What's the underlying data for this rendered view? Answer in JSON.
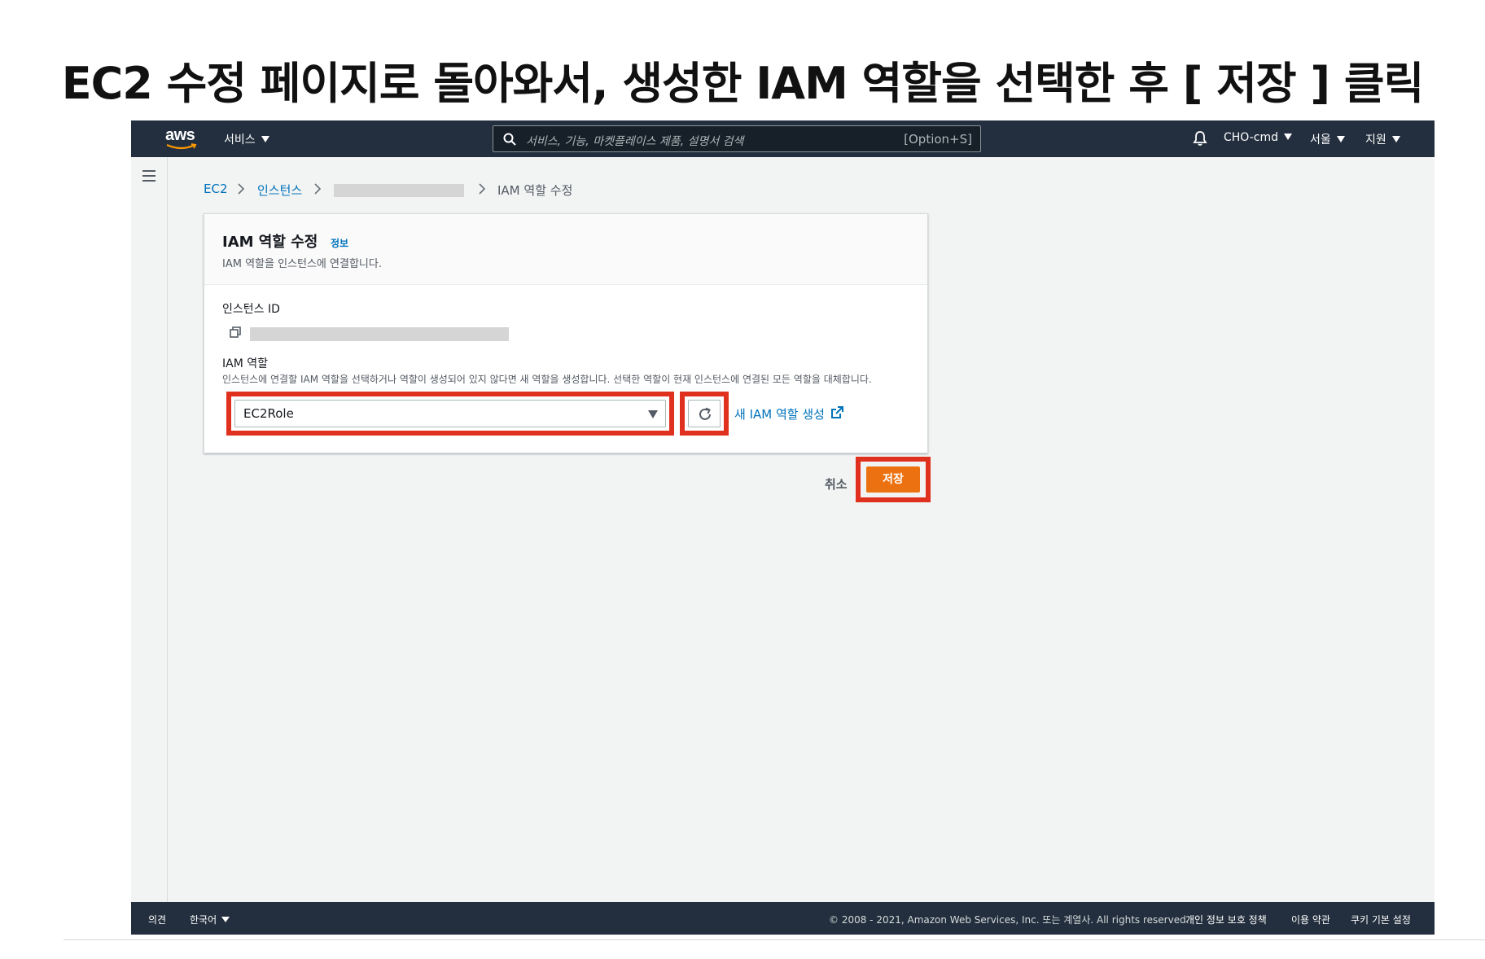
{
  "slide": {
    "title": "EC2 수정 페이지로 돌아와서, 생성한 IAM 역할을 선택한 후 [ 저장 ] 클릭"
  },
  "topnav": {
    "logo_text": "aws",
    "services_label": "서비스",
    "search_placeholder": "서비스, 기능, 마켓플레이스 제품, 설명서 검색",
    "search_shortcut": "[Option+S]",
    "account_label": "CHO-cmd",
    "region_label": "서울",
    "support_label": "지원"
  },
  "breadcrumb": {
    "ec2": "EC2",
    "instances": "인스턴스",
    "current": "IAM 역할 수정"
  },
  "panel": {
    "title": "IAM 역할 수정",
    "info_link": "정보",
    "description": "IAM 역할을 인스턴스에 연결합니다.",
    "instance_id_label": "인스턴스 ID",
    "iam_role_label": "IAM 역할",
    "iam_role_description": "인스턴스에 연결할 IAM 역할을 선택하거나 역할이 생성되어 있지 않다면 새 역할을 생성합니다. 선택한 역할이 현재 인스턴스에 연결된 모든 역할을 대체합니다.",
    "selected_role": "EC2Role",
    "create_role_link": "새 IAM 역할 생성"
  },
  "actions": {
    "cancel_label": "취소",
    "save_label": "저장"
  },
  "footer": {
    "feedback": "의견",
    "language": "한국어",
    "copyright": "© 2008 - 2021, Amazon Web Services, Inc. 또는 계열사. All rights reserved.",
    "privacy": "개인 정보 보호 정책",
    "terms": "이용 약관",
    "cookies": "쿠키 기본 설정"
  },
  "colors": {
    "nav_bg": "#232f3e",
    "link": "#0073bb",
    "primary": "#ec7211",
    "highlight": "#e0301e",
    "page_bg": "#f2f3f3"
  }
}
